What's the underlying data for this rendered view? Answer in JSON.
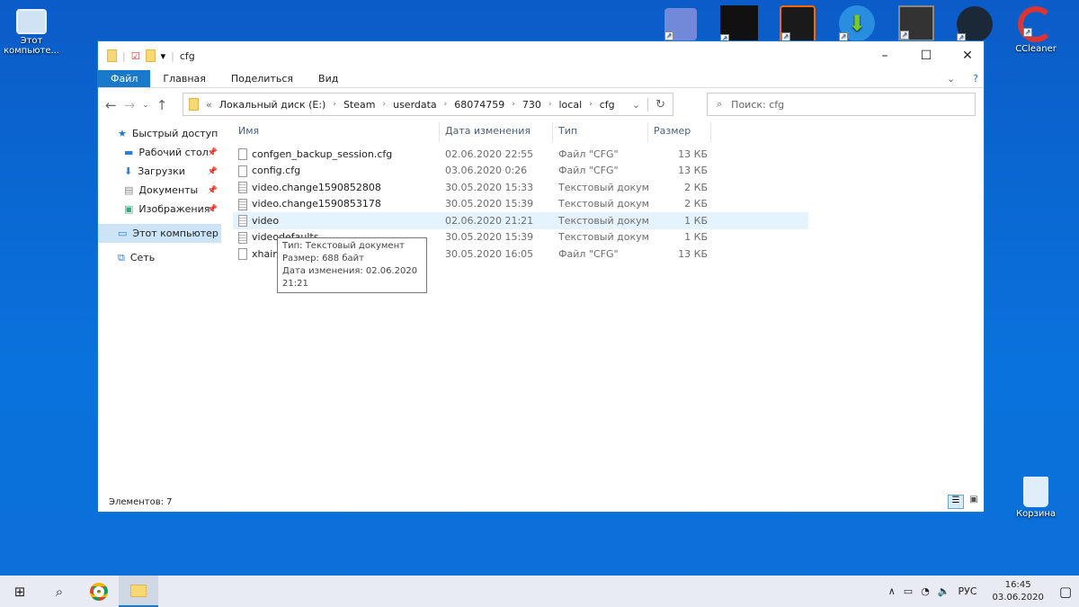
{
  "desktop": {
    "icons": [
      {
        "label": "Этот компьюте..."
      },
      {
        "label": "CCleaner"
      },
      {
        "label": "Корзина"
      }
    ]
  },
  "window": {
    "title": "cfg"
  },
  "ribbon": {
    "tabs": [
      "Файл",
      "Главная",
      "Поделиться",
      "Вид"
    ]
  },
  "address": {
    "prefix": "«",
    "crumbs": [
      "Локальный диск (E:)",
      "Steam",
      "userdata",
      "68074759",
      "730",
      "local",
      "cfg"
    ]
  },
  "search": {
    "placeholder": "Поиск: cfg"
  },
  "sidebar": {
    "items": [
      {
        "label": "Быстрый доступ",
        "icon": "star-icon"
      },
      {
        "label": "Рабочий стол",
        "icon": "desktop-icon",
        "pinned": true
      },
      {
        "label": "Загрузки",
        "icon": "download-icon",
        "pinned": true
      },
      {
        "label": "Документы",
        "icon": "documents-icon",
        "pinned": true
      },
      {
        "label": "Изображения",
        "icon": "pictures-icon",
        "pinned": true
      },
      {
        "label": "Этот компьютер",
        "icon": "computer-icon",
        "selected": true
      },
      {
        "label": "Сеть",
        "icon": "network-icon"
      }
    ]
  },
  "columns": [
    "Имя",
    "Дата изменения",
    "Тип",
    "Размер"
  ],
  "files": [
    {
      "name": "confgen_backup_session.cfg",
      "date": "02.06.2020 22:55",
      "type": "Файл \"CFG\"",
      "size": "13 КБ",
      "icon": "file"
    },
    {
      "name": "config.cfg",
      "date": "03.06.2020 0:26",
      "type": "Файл \"CFG\"",
      "size": "13 КБ",
      "icon": "file"
    },
    {
      "name": "video.change1590852808",
      "date": "30.05.2020 15:33",
      "type": "Текстовый докум...",
      "size": "2 КБ",
      "icon": "txt"
    },
    {
      "name": "video.change1590853178",
      "date": "30.05.2020 15:39",
      "type": "Текстовый докум...",
      "size": "2 КБ",
      "icon": "txt"
    },
    {
      "name": "video",
      "date": "02.06.2020 21:21",
      "type": "Текстовый докум...",
      "size": "1 КБ",
      "icon": "txt"
    },
    {
      "name": "videodefaults",
      "date": "30.05.2020 15:39",
      "type": "Текстовый докум...",
      "size": "1 КБ",
      "icon": "txt"
    },
    {
      "name": "xhair",
      "date": "30.05.2020 16:05",
      "type": "Файл \"CFG\"",
      "size": "13 КБ",
      "icon": "file"
    }
  ],
  "tooltip": {
    "line1": "Тип: Текстовый документ",
    "line2": "Размер: 688 байт",
    "line3": "Дата изменения: 02.06.2020 21:21"
  },
  "status": {
    "count": "Элементов: 7"
  },
  "tray": {
    "lang": "РУС",
    "time": "16:45",
    "date": "03.06.2020"
  }
}
